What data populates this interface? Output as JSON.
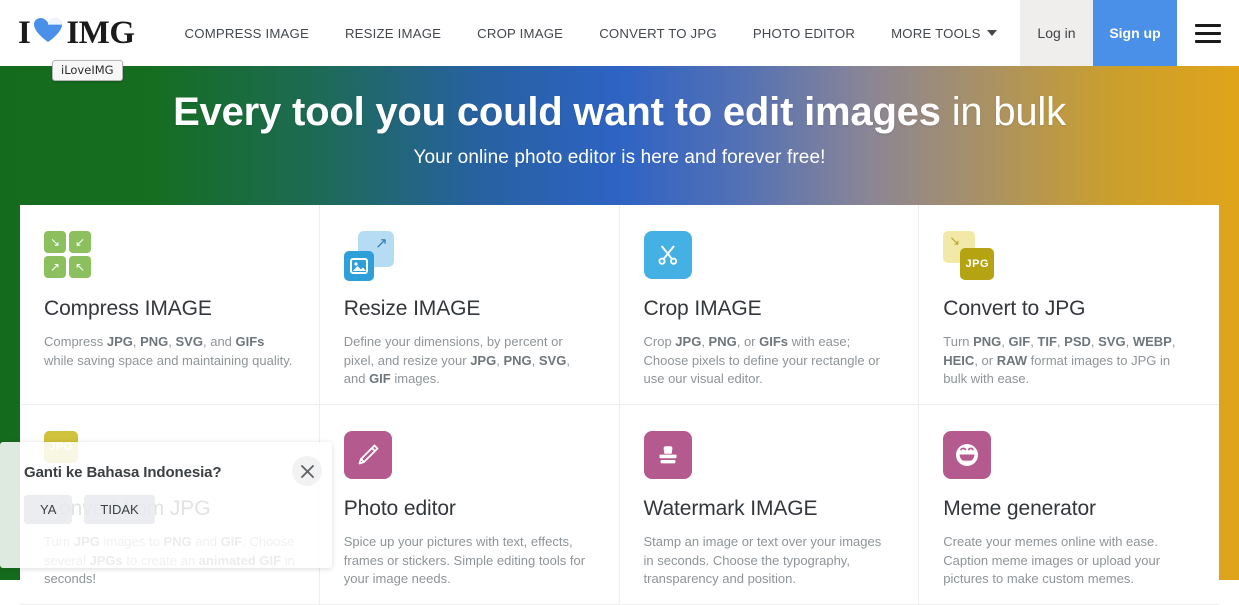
{
  "header": {
    "logo": {
      "pre": "I",
      "heart": "heart-icon",
      "post": "IMG"
    },
    "nav": [
      {
        "label": "COMPRESS IMAGE",
        "name": "nav-compress-image"
      },
      {
        "label": "RESIZE IMAGE",
        "name": "nav-resize-image"
      },
      {
        "label": "CROP IMAGE",
        "name": "nav-crop-image"
      },
      {
        "label": "CONVERT TO JPG",
        "name": "nav-convert-to-jpg"
      },
      {
        "label": "PHOTO EDITOR",
        "name": "nav-photo-editor"
      },
      {
        "label": "MORE TOOLS",
        "name": "nav-more-tools"
      }
    ],
    "login_label": "Log in",
    "signup_label": "Sign up",
    "menu_icon": "hamburger-menu-icon",
    "colors": {
      "signup_bg": "#4a90e8",
      "login_bg": "#f0eeec"
    }
  },
  "tooltip": {
    "text": "iLoveIMG"
  },
  "hero": {
    "title_part1": "Every tool you could want to ",
    "title_strong": "edit images",
    "title_part2": " in bulk",
    "subtitle": "Your online photo editor is here and forever free!",
    "gradient": [
      "#156b1d",
      "#2e63c4",
      "#e0a41a"
    ]
  },
  "cards": [
    {
      "name": "card-compress-image",
      "icon": "compress-arrows-icon",
      "icon_color": "#8cbf5e",
      "title": "Compress IMAGE",
      "desc_html": "Compress <b>JPG</b>, <b>PNG</b>, <b>SVG</b>, and <b>GIFs</b> while saving space and maintaining quality."
    },
    {
      "name": "card-resize-image",
      "icon": "resize-expand-icon",
      "icon_color": "#2f9fd9",
      "title": "Resize IMAGE",
      "desc_html": "Define your dimensions, by percent or pixel, and resize your <b>JPG</b>, <b>PNG</b>, <b>SVG</b>, and <b>GIF</b> images."
    },
    {
      "name": "card-crop-image",
      "icon": "scissors-icon",
      "icon_color": "#45b0e3",
      "title": "Crop IMAGE",
      "desc_html": "Crop <b>JPG</b>, <b>PNG</b>, or <b>GIFs</b> with ease; Choose pixels to define your rectangle or use our visual editor."
    },
    {
      "name": "card-convert-to-jpg",
      "icon": "convert-jpg-icon",
      "icon_color": "#b5a311",
      "icon_label": "JPG",
      "title": "Convert to JPG",
      "desc_html": "Turn <b>PNG</b>, <b>GIF</b>, <b>TIF</b>, <b>PSD</b>, <b>SVG</b>, <b>WEBP</b>, <b>HEIC</b>, or <b>RAW</b> format images to JPG in bulk with ease."
    },
    {
      "name": "card-convert-from-jpg",
      "icon": "convert-from-jpg-icon",
      "icon_color": "#b5a311",
      "icon_label": "JPG",
      "title": "Convert from JPG",
      "desc_html": "Turn <b>JPG</b> images to <b>PNG</b> and <b>GIF</b>. Choose several <b>JPGs</b> to create an <b>animated GIF</b> in seconds!"
    },
    {
      "name": "card-photo-editor",
      "icon": "pencil-icon",
      "icon_color": "#b45a8e",
      "title": "Photo editor",
      "desc_html": "Spice up your pictures with text, effects, frames or stickers. Simple editing tools for your image needs."
    },
    {
      "name": "card-watermark-image",
      "icon": "stamp-icon",
      "icon_color": "#b45a8e",
      "title": "Watermark IMAGE",
      "desc_html": "Stamp an image or text over your images in seconds. Choose the typography, transparency and position."
    },
    {
      "name": "card-meme-generator",
      "icon": "smiley-face-icon",
      "icon_color": "#b45a8e",
      "title": "Meme generator",
      "desc_html": "Create your memes online with ease. Caption meme images or upload your pictures to make custom memes."
    }
  ],
  "translate_popup": {
    "title": "Ganti ke Bahasa Indonesia?",
    "yes_label": "YA",
    "no_label": "TIDAK",
    "close_icon": "close-icon"
  }
}
